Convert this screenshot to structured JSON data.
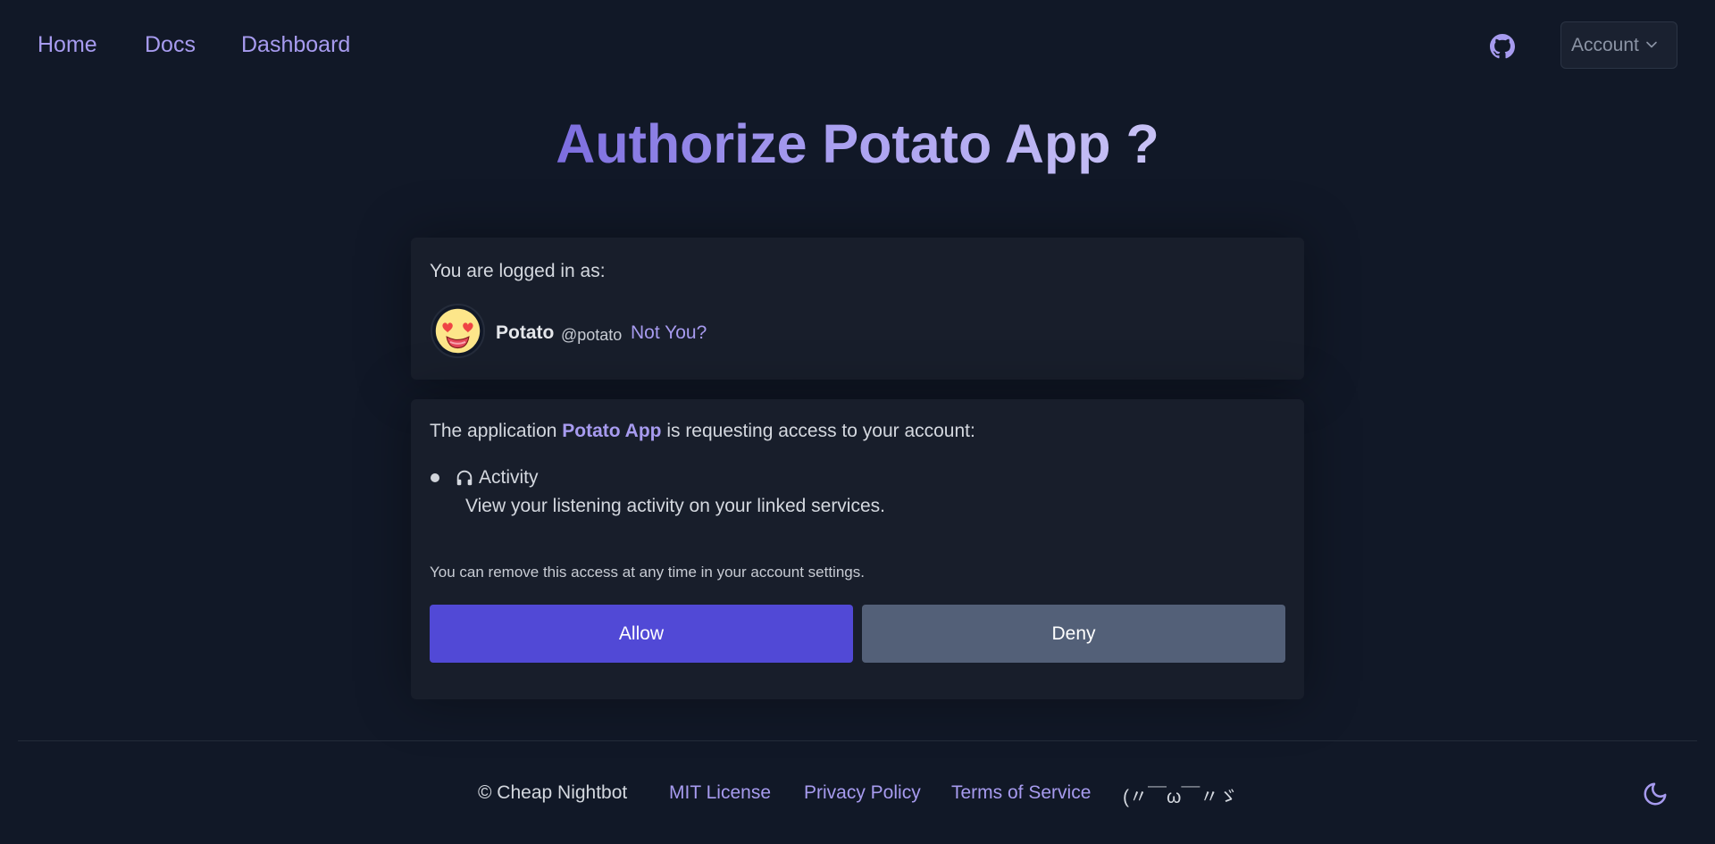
{
  "nav": {
    "links": [
      "Home",
      "Docs",
      "Dashboard"
    ],
    "account_label": "Account",
    "github_icon": "github-icon"
  },
  "title": "Authorize Potato App ?",
  "login_card": {
    "label": "You are logged in as:",
    "display_name": "Potato",
    "handle": "@potato",
    "not_you": "Not You?"
  },
  "request_card": {
    "prefix": "The application ",
    "app_name": "Potato App",
    "suffix": " is requesting access to your account:",
    "permissions": [
      {
        "icon": "headphones-icon",
        "name": "Activity",
        "description": "View your listening activity on your linked services."
      }
    ],
    "note": "You can remove this access at any time in your account settings.",
    "allow_label": "Allow",
    "deny_label": "Deny"
  },
  "footer": {
    "copyright": "© Cheap Nightbot",
    "links": [
      "MIT License",
      "Privacy Policy",
      "Terms of Service"
    ],
    "kaomoji": "(〃￣ω￣〃ゞ",
    "theme_icon": "moon-icon"
  },
  "colors": {
    "background": "#111827",
    "card": "#181e2b",
    "accent": "#a79bef",
    "allow": "#5149d6",
    "deny": "#536078"
  }
}
